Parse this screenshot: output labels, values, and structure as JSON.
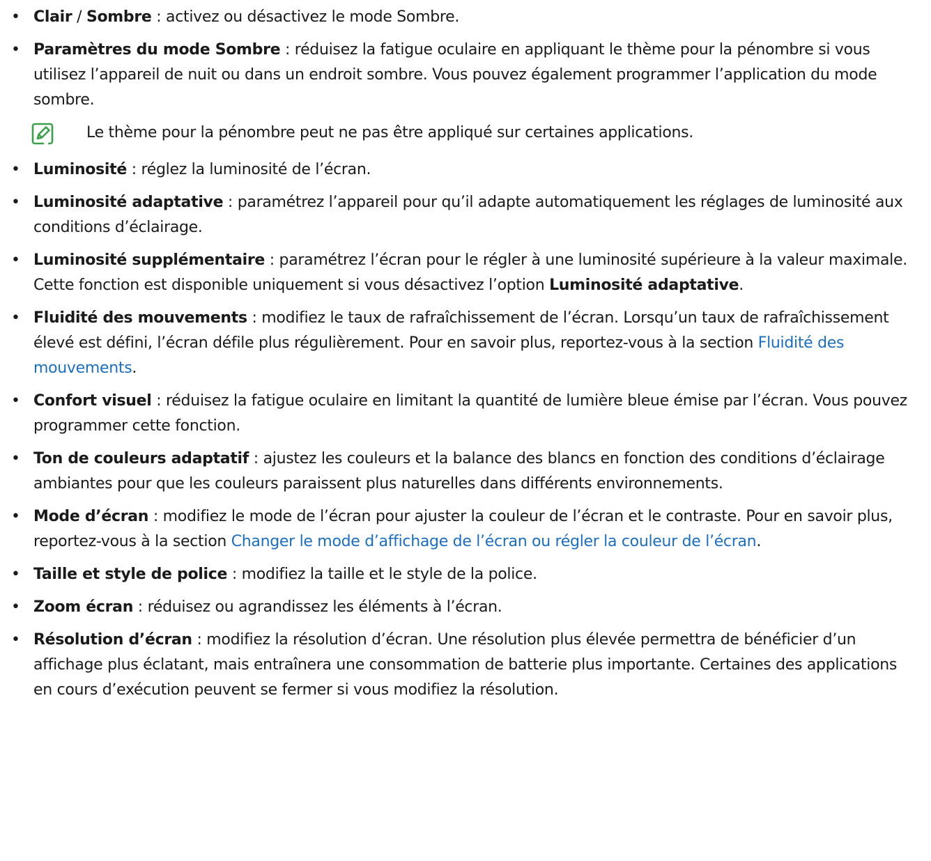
{
  "items": [
    {
      "id": "clair",
      "parts": [
        {
          "t": "Clair",
          "s": "term"
        },
        {
          "t": " / "
        },
        {
          "t": "Sombre",
          "s": "term"
        },
        {
          "t": " : activez ou désactivez le mode Sombre."
        }
      ]
    },
    {
      "id": "parametres-sombre",
      "parts": [
        {
          "t": "Paramètres du mode Sombre",
          "s": "term"
        },
        {
          "t": " : réduisez la fatigue oculaire en appliquant le thème pour la pénombre si vous utilisez l’appareil de nuit ou dans un endroit sombre. Vous pouvez également programmer l’application du mode sombre."
        }
      ]
    },
    {
      "id": "luminosite",
      "parts": [
        {
          "t": "Luminosité",
          "s": "term"
        },
        {
          "t": " : réglez la luminosité de l’écran."
        }
      ]
    },
    {
      "id": "luminosite-adaptative",
      "parts": [
        {
          "t": "Luminosité adaptative",
          "s": "term"
        },
        {
          "t": " : paramétrez l’appareil pour qu’il adapte automatiquement les réglages de luminosité aux conditions d’éclairage."
        }
      ]
    },
    {
      "id": "luminosite-supplementaire",
      "parts": [
        {
          "t": "Luminosité supplémentaire",
          "s": "term"
        },
        {
          "t": " : paramétrez l’écran pour le régler à une luminosité supérieure à la valeur maximale. Cette fonction est disponible uniquement si vous désactivez l’option "
        },
        {
          "t": "Luminosité adaptative",
          "s": "term"
        },
        {
          "t": "."
        }
      ]
    },
    {
      "id": "fluidite",
      "parts": [
        {
          "t": "Fluidité des mouvements",
          "s": "term"
        },
        {
          "t": " : modifiez le taux de rafraîchissement de l’écran. Lorsqu’un taux de rafraîchissement élevé est défini, l’écran défile plus régulièrement. Pour en savoir plus, reportez-vous à la section "
        },
        {
          "t": "Fluidité des mouvements",
          "s": "link"
        },
        {
          "t": "."
        }
      ]
    },
    {
      "id": "confort-visuel",
      "parts": [
        {
          "t": "Confort visuel",
          "s": "term"
        },
        {
          "t": " : réduisez la fatigue oculaire en limitant la quantité de lumière bleue émise par l’écran. Vous pouvez programmer cette fonction."
        }
      ]
    },
    {
      "id": "ton-couleurs",
      "parts": [
        {
          "t": "Ton de couleurs adaptatif",
          "s": "term"
        },
        {
          "t": " : ajustez les couleurs et la balance des blancs en fonction des conditions d’éclairage ambiantes pour que les couleurs paraissent plus naturelles dans différents environnements."
        }
      ]
    },
    {
      "id": "mode-ecran",
      "parts": [
        {
          "t": "Mode d’écran",
          "s": "term"
        },
        {
          "t": " : modifiez le mode de l’écran pour ajuster la couleur de l’écran et le contraste. Pour en savoir plus, reportez-vous à la section "
        },
        {
          "t": "Changer le mode d’affichage de l’écran ou régler la couleur de l’écran",
          "s": "link"
        },
        {
          "t": "."
        }
      ]
    },
    {
      "id": "taille-police",
      "parts": [
        {
          "t": "Taille et style de police",
          "s": "term"
        },
        {
          "t": " : modifiez la taille et le style de la police."
        }
      ]
    },
    {
      "id": "zoom-ecran",
      "parts": [
        {
          "t": "Zoom écran",
          "s": "term"
        },
        {
          "t": " : réduisez ou agrandissez les éléments à l’écran."
        }
      ]
    },
    {
      "id": "resolution",
      "parts": [
        {
          "t": "Résolution d’écran",
          "s": "term"
        },
        {
          "t": " : modifiez la résolution d’écran. Une résolution plus élevée permettra de bénéficier d’un affichage plus éclatant, mais entraînera une consommation de batterie plus importante. Certaines des applications en cours d’exécution peuvent se fermer si vous modifiez la résolution."
        }
      ]
    }
  ],
  "note": {
    "after_item": "parametres-sombre",
    "icon": "note-pencil-icon",
    "text": "Le thème pour la pénombre peut ne pas être appliqué sur certaines applications."
  },
  "bullet_char": "•",
  "colors": {
    "link": "#1a6fc4",
    "icon": "#3aa14a",
    "text": "#1a1a1a"
  }
}
